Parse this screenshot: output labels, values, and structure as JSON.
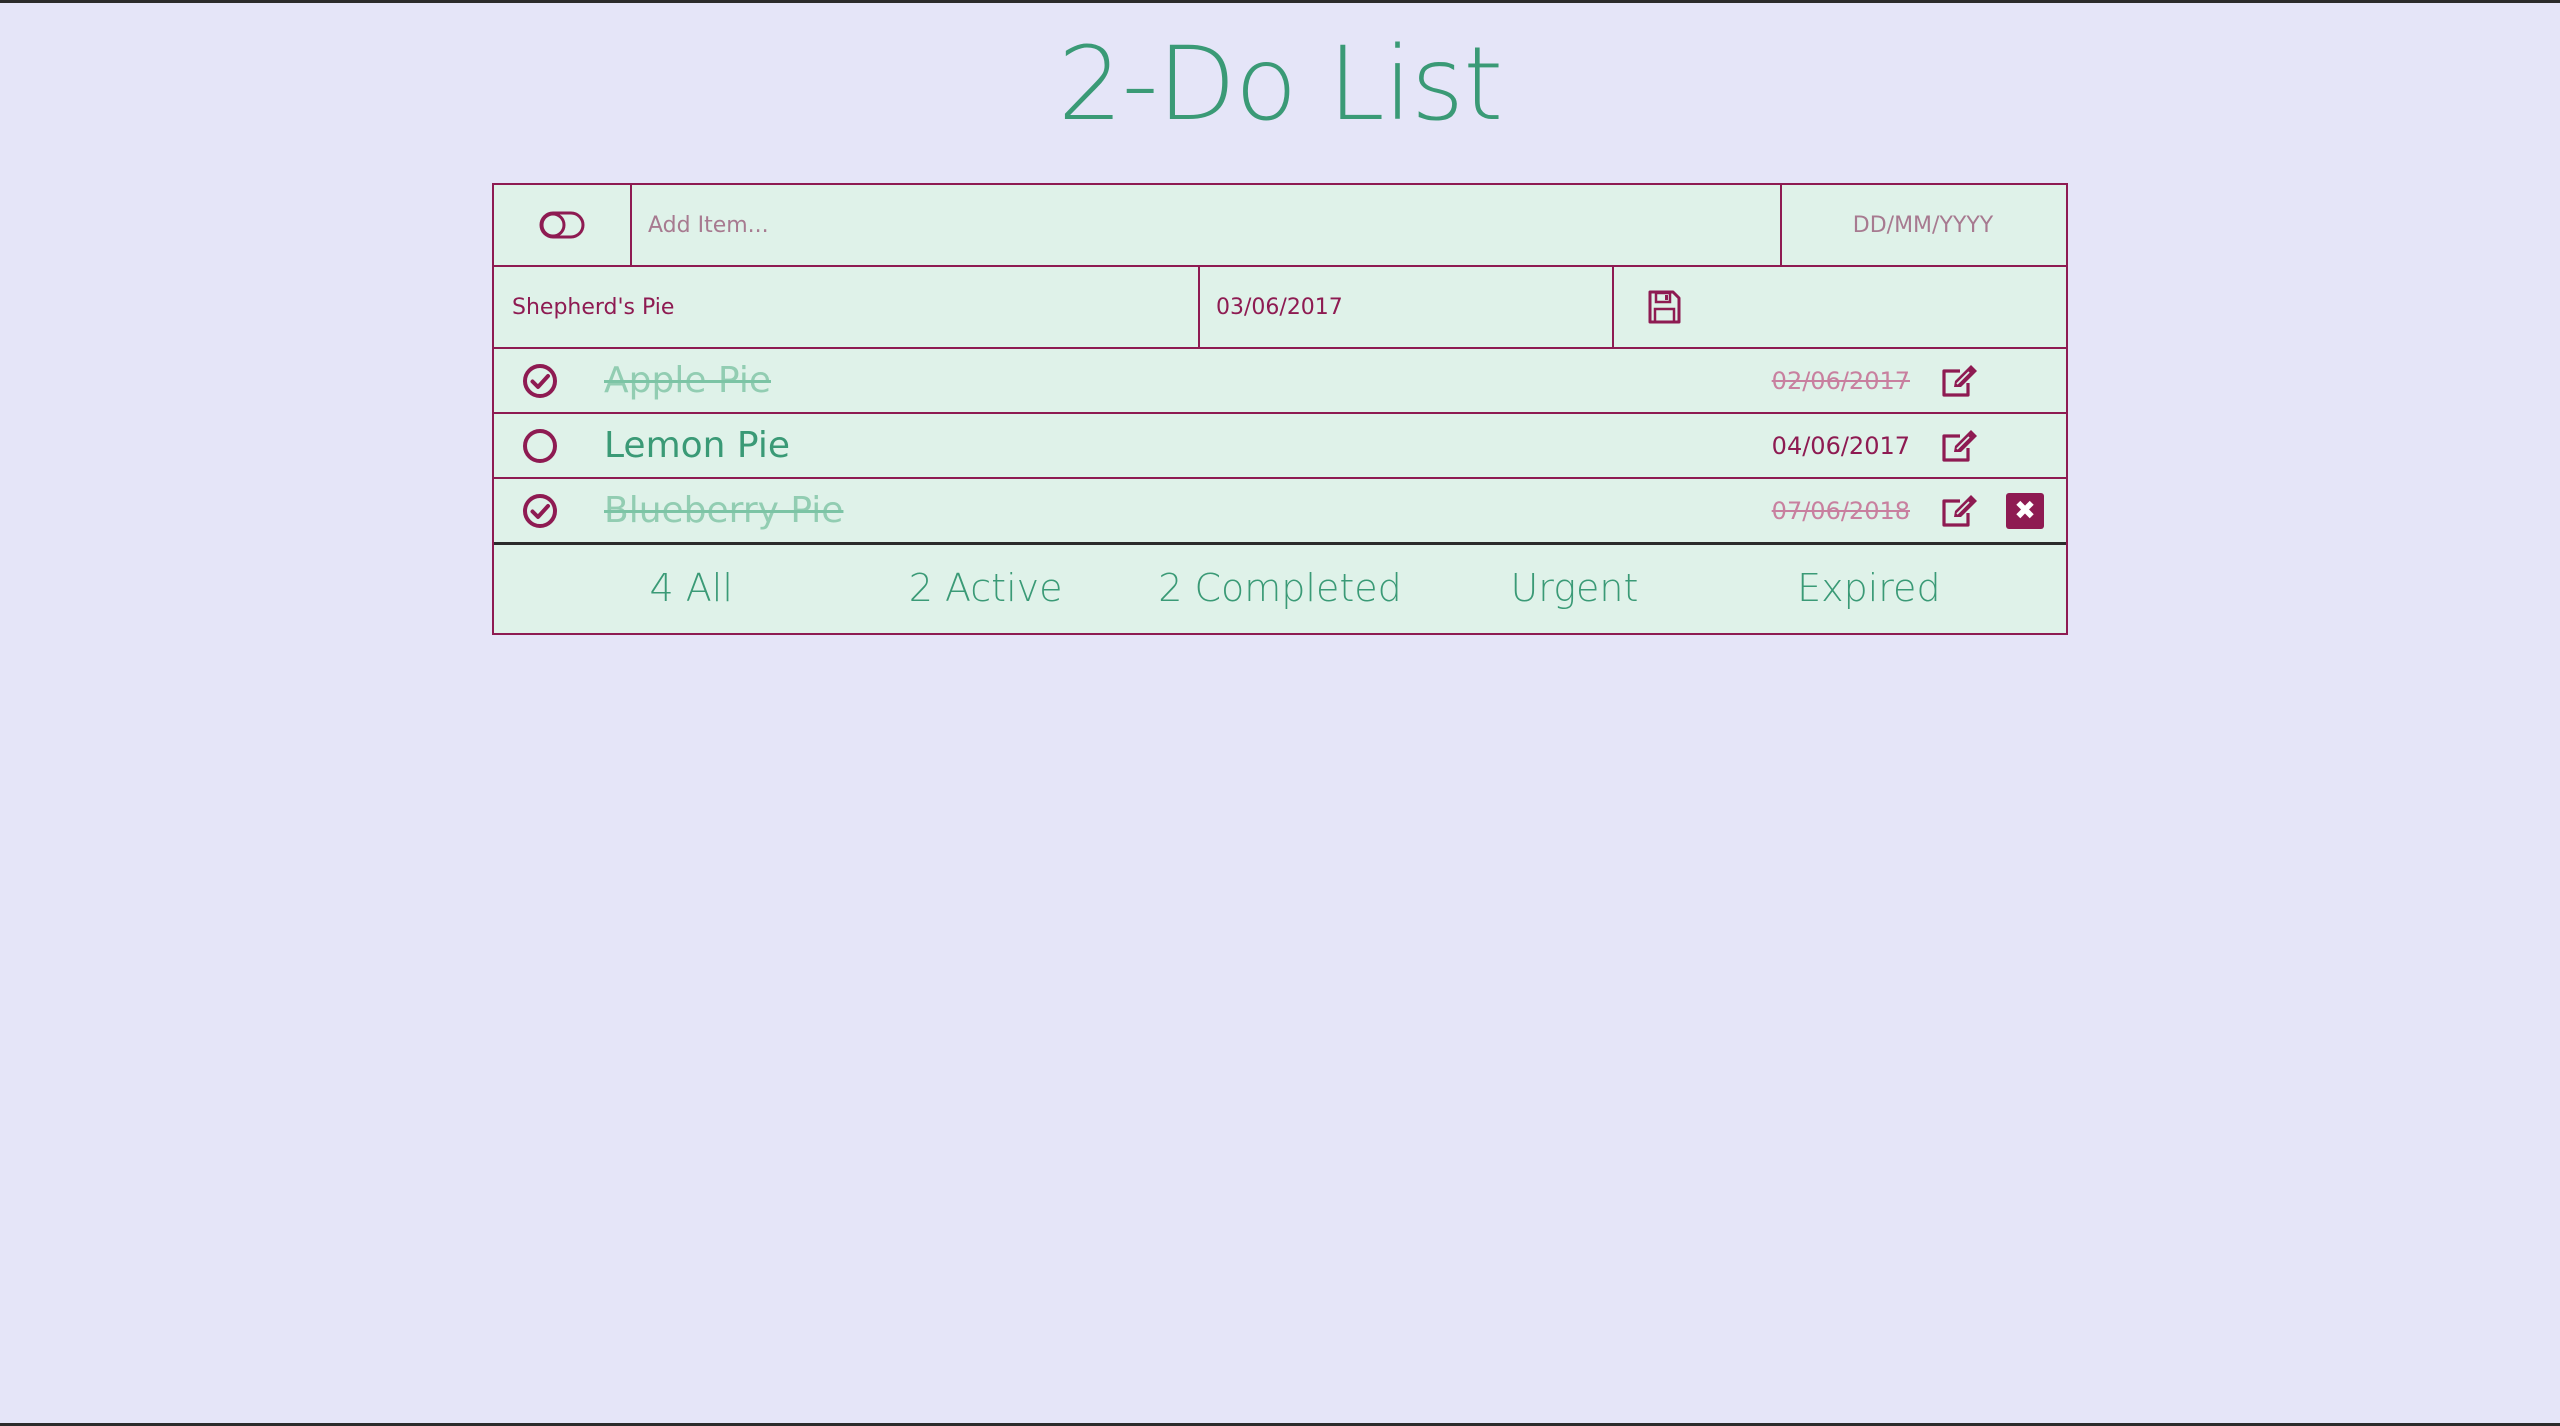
{
  "app": {
    "title": "2-Do List"
  },
  "colors": {
    "background": "#e5e5f8",
    "panel": "#dff2e9",
    "accent": "#8e1b52",
    "text_green": "#3a9a76"
  },
  "add_row": {
    "toggle_icon": "toggle-off-icon",
    "item_placeholder": "Add Item...",
    "date_placeholder": "DD/MM/YYYY"
  },
  "edit_row": {
    "name_value": "Shepherd's Pie",
    "date_value": "03/06/2017",
    "save_icon": "floppy-disk-icon"
  },
  "items": [
    {
      "name": "Apple Pie",
      "date": "02/06/2017",
      "completed": true
    },
    {
      "name": "Lemon Pie",
      "date": "04/06/2017",
      "completed": false
    },
    {
      "name": "Blueberry Pie",
      "date": "07/06/2018",
      "completed": true,
      "delete_icon": "close-icon",
      "delete_label": "✖"
    }
  ],
  "filters": {
    "all": "4 All",
    "active": "2 Active",
    "completed": "2 Completed",
    "urgent": "Urgent",
    "expired": "Expired"
  }
}
